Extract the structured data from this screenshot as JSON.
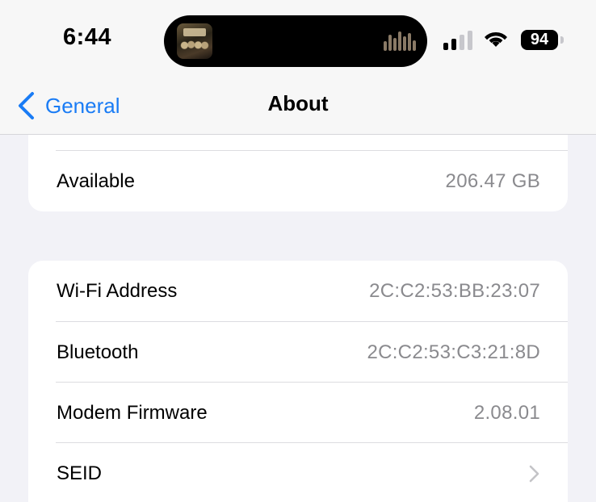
{
  "status_bar": {
    "time": "6:44",
    "battery_level": "94",
    "signal_bars_active": 2,
    "signal_bars_total": 4
  },
  "nav": {
    "back_label": "General",
    "title": "About"
  },
  "storage_group": {
    "rows": [
      {
        "label": "Available",
        "value": "206.47 GB"
      }
    ]
  },
  "network_group": {
    "rows": [
      {
        "label": "Wi-Fi Address",
        "value": "2C:C2:53:BB:23:07"
      },
      {
        "label": "Bluetooth",
        "value": "2C:C2:53:C3:21:8D"
      },
      {
        "label": "Modem Firmware",
        "value": "2.08.01"
      },
      {
        "label": "SEID",
        "value": ""
      }
    ]
  },
  "colors": {
    "accent": "#1a7cf5",
    "background": "#f2f2f7",
    "secondary_text": "#8a8a8e"
  },
  "icons": {
    "back": "chevron-left-icon",
    "disclosure": "chevron-right-icon",
    "wifi": "wifi-icon",
    "signal": "cellular-signal-icon",
    "battery": "battery-icon",
    "now_playing": "waveform-icon"
  }
}
